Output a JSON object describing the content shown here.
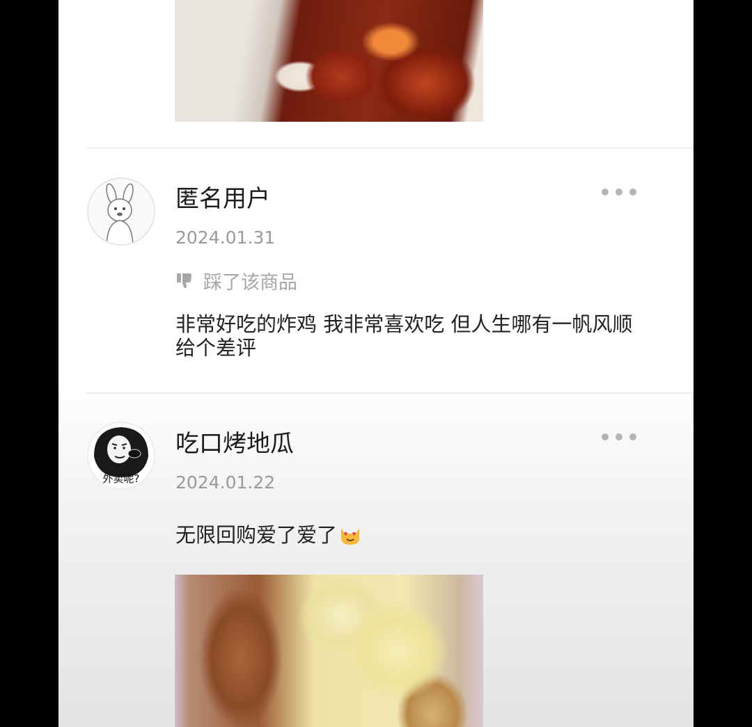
{
  "reviews": [
    {
      "username": "匿名用户",
      "date": "2024.01.31",
      "reaction_label": "踩了该商品",
      "comment": "非常好吃的炸鸡 我非常喜欢吃 但人生哪有一帆风顺 给个差评",
      "avatar": "kangaroo-avatar"
    },
    {
      "username": "吃口烤地瓜",
      "date": "2024.01.22",
      "comment": "无限回购爱了爱了",
      "comment_emoji": "heart-eyes-cat-emoji",
      "avatar_caption": "外卖呢?",
      "avatar": "meme-face-avatar"
    }
  ],
  "icons": {
    "more": "more-dots-icon",
    "dislike": "thumbs-down-icon"
  },
  "colors": {
    "username": "#1b1b1b",
    "date": "#9a9a9a",
    "meta": "#a6a6a6",
    "divider": "#ececec"
  }
}
